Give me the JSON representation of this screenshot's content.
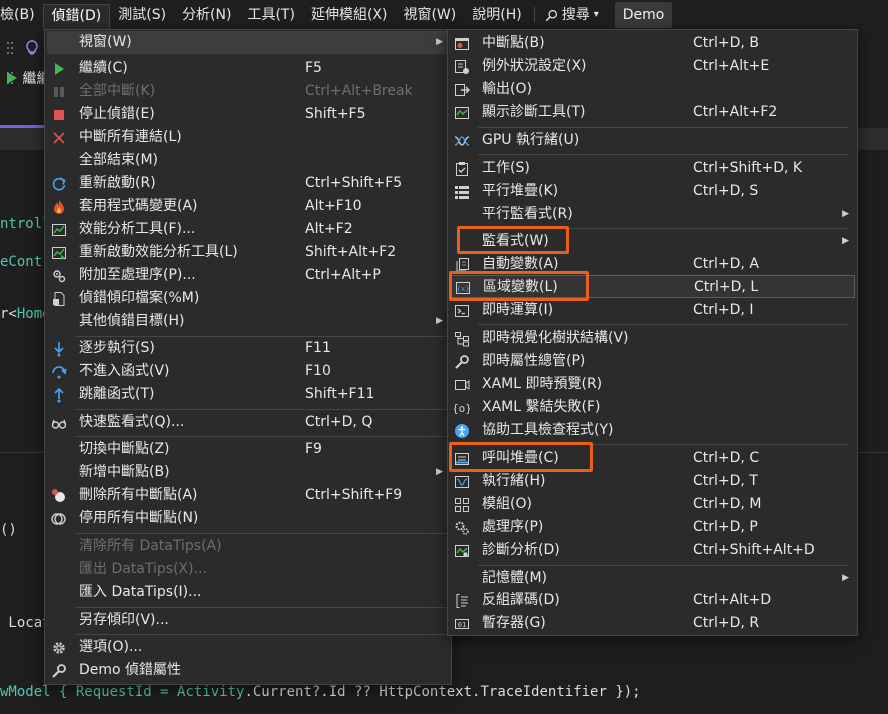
{
  "menubar": {
    "items": [
      {
        "label": "檢視(V)",
        "name": "menubar-view"
      },
      {
        "label": "偵錯(D)",
        "name": "menubar-debug"
      },
      {
        "label": "測試(S)",
        "name": "menubar-test"
      },
      {
        "label": "分析(N)",
        "name": "menubar-analyze"
      },
      {
        "label": "工具(T)",
        "name": "menubar-tools"
      },
      {
        "label": "延伸模組(X)",
        "name": "menubar-extensions"
      },
      {
        "label": "視窗(W)",
        "name": "menubar-window"
      },
      {
        "label": "說明(H)",
        "name": "menubar-help"
      }
    ],
    "view_visible_fragment": "檢(B)",
    "search_label": "搜尋",
    "search_caret": "▾",
    "solution_badge": "Demo"
  },
  "toolbar": {
    "continue_fragment": "繼續"
  },
  "code": {
    "line1": "ntroll",
    "line2": "eContr",
    "line3": "r<",
    "line3_home": "Home",
    "lower1": "()",
    "lower2": " Locat",
    "last_line": {
      "p1": "wModel { RequestId = ",
      "p2": "Activity",
      "p3": ".Current?.Id ?? HttpContext.TraceIdentifier });"
    }
  },
  "debug_menu": {
    "items": [
      {
        "label": "視窗(W)",
        "shortcut": "",
        "submenu": true,
        "icon": "none"
      },
      {
        "label": "繼續(C)",
        "shortcut": "F5",
        "icon": "play-icon"
      },
      {
        "label": "全部中斷(K)",
        "shortcut": "Ctrl+Alt+Break",
        "disabled": true,
        "icon": "pause-icon"
      },
      {
        "label": "停止偵錯(E)",
        "shortcut": "Shift+F5",
        "icon": "stop-icon"
      },
      {
        "label": "中斷所有連結(L)",
        "shortcut": "",
        "icon": "close-icon"
      },
      {
        "label": "全部結束(M)",
        "shortcut": "",
        "icon": "none"
      },
      {
        "label": "重新啟動(R)",
        "shortcut": "Ctrl+Shift+F5",
        "icon": "restart-icon"
      },
      {
        "label": "套用程式碼變更(A)",
        "shortcut": "Alt+F10",
        "icon": "hot-reload-icon"
      },
      {
        "label": "效能分析工具(F)...",
        "shortcut": "Alt+F2",
        "icon": "performance-profiler-icon"
      },
      {
        "label": "重新啟動效能分析工具(L)",
        "shortcut": "Shift+Alt+F2",
        "icon": "relaunch-profiler-icon"
      },
      {
        "label": "附加至處理序(P)...",
        "shortcut": "Ctrl+Alt+P",
        "icon": "attach-process-icon"
      },
      {
        "label": "偵錯傾印檔案(%M)",
        "shortcut": "",
        "icon": "dump-file-icon"
      },
      {
        "label": "其他偵錯目標(H)",
        "shortcut": "",
        "submenu": true,
        "icon": "none"
      },
      {
        "label": "逐步執行(S)",
        "shortcut": "F11",
        "icon": "step-into-icon"
      },
      {
        "label": "不進入函式(V)",
        "shortcut": "F10",
        "icon": "step-over-icon"
      },
      {
        "label": "跳離函式(T)",
        "shortcut": "Shift+F11",
        "icon": "step-out-icon"
      },
      {
        "label": "快速監看式(Q)...",
        "shortcut": "Ctrl+D, Q",
        "icon": "quick-watch-icon"
      },
      {
        "label": "切換中斷點(Z)",
        "shortcut": "F9",
        "icon": "none"
      },
      {
        "label": "新增中斷點(B)",
        "shortcut": "",
        "submenu": true,
        "icon": "none"
      },
      {
        "label": "刪除所有中斷點(A)",
        "shortcut": "Ctrl+Shift+F9",
        "icon": "delete-breakpoints-icon"
      },
      {
        "label": "停用所有中斷點(N)",
        "shortcut": "",
        "icon": "disable-breakpoints-icon"
      },
      {
        "label": "清除所有 DataTips(A)",
        "shortcut": "",
        "disabled": true,
        "icon": "none"
      },
      {
        "label": "匯出 DataTips(X)...",
        "shortcut": "",
        "disabled": true,
        "icon": "none"
      },
      {
        "label": "匯入 DataTips(I)...",
        "shortcut": "",
        "icon": "none"
      },
      {
        "label": "另存傾印(V)...",
        "shortcut": "",
        "icon": "none"
      },
      {
        "label": "選項(O)...",
        "shortcut": "",
        "icon": "gear-icon"
      },
      {
        "label": "Demo 偵錯屬性",
        "shortcut": "",
        "icon": "wrench-icon"
      }
    ]
  },
  "window_submenu": {
    "items": [
      {
        "label": "中斷點(B)",
        "shortcut": "Ctrl+D, B",
        "icon": "breakpoints-window-icon"
      },
      {
        "label": "例外狀況設定(X)",
        "shortcut": "Ctrl+Alt+E",
        "icon": "exception-settings-icon"
      },
      {
        "label": "輸出(O)",
        "shortcut": "",
        "icon": "output-icon"
      },
      {
        "label": "顯示診斷工具(T)",
        "shortcut": "Ctrl+Alt+F2",
        "icon": "diagnostic-tools-icon"
      },
      {
        "label": "GPU 執行緒(U)",
        "shortcut": "",
        "icon": "gpu-threads-icon"
      },
      {
        "label": "工作(S)",
        "shortcut": "Ctrl+Shift+D, K",
        "icon": "tasks-icon"
      },
      {
        "label": "平行堆疊(K)",
        "shortcut": "Ctrl+D, S",
        "icon": "parallel-stacks-icon"
      },
      {
        "label": "平行監看式(R)",
        "shortcut": "",
        "submenu": true,
        "icon": "none"
      },
      {
        "label": "監看式(W)",
        "shortcut": "",
        "submenu": true,
        "icon": "none"
      },
      {
        "label": "自動變數(A)",
        "shortcut": "Ctrl+D, A",
        "icon": "autos-icon"
      },
      {
        "label": "區域變數(L)",
        "shortcut": "Ctrl+D, L",
        "icon": "locals-icon"
      },
      {
        "label": "即時運算(I)",
        "shortcut": "Ctrl+D, I",
        "icon": "immediate-icon"
      },
      {
        "label": "即時視覺化樹狀結構(V)",
        "shortcut": "",
        "icon": "live-visual-tree-icon"
      },
      {
        "label": "即時屬性總管(P)",
        "shortcut": "",
        "icon": "live-property-explorer-icon"
      },
      {
        "label": "XAML 即時預覽(R)",
        "shortcut": "",
        "icon": "xaml-preview-icon"
      },
      {
        "label": "XAML 繫結失敗(F)",
        "shortcut": "",
        "icon": "xaml-binding-icon"
      },
      {
        "label": "協助工具檢查程式(Y)",
        "shortcut": "",
        "icon": "accessibility-icon"
      },
      {
        "label": "呼叫堆疊(C)",
        "shortcut": "Ctrl+D, C",
        "icon": "call-stack-icon"
      },
      {
        "label": "執行緒(H)",
        "shortcut": "Ctrl+D, T",
        "icon": "threads-icon"
      },
      {
        "label": "模組(O)",
        "shortcut": "Ctrl+D, M",
        "icon": "modules-icon"
      },
      {
        "label": "處理序(P)",
        "shortcut": "Ctrl+D, P",
        "icon": "processes-icon"
      },
      {
        "label": "診斷分析(D)",
        "shortcut": "Ctrl+Shift+Alt+D",
        "icon": "diagnostic-analysis-icon"
      },
      {
        "label": "記憶體(M)",
        "shortcut": "",
        "submenu": true,
        "icon": "none"
      },
      {
        "label": "反組譯碼(D)",
        "shortcut": "Ctrl+Alt+D",
        "icon": "disassembly-icon"
      },
      {
        "label": "暫存器(G)",
        "shortcut": "Ctrl+D, R",
        "icon": "registers-icon"
      }
    ]
  },
  "colors": {
    "highlight_box": "#e8601c",
    "accent_purple": "#7160e8",
    "play_green": "#3fb950",
    "stop_red": "#e35353",
    "icon_blue": "#4aa3f0"
  }
}
